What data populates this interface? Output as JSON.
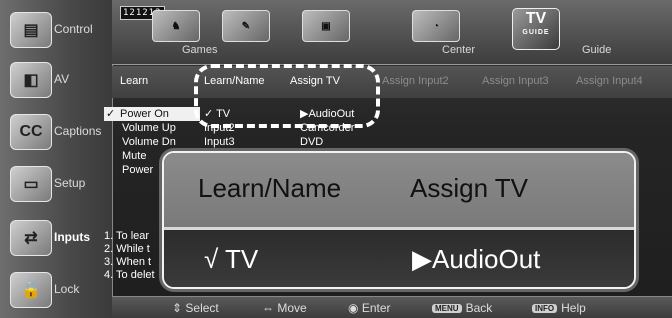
{
  "topbar": {
    "logo_digits": "121212",
    "tabs": [
      "Games",
      "",
      "Center",
      ""
    ],
    "tvguide": {
      "title": "TV",
      "sub": "GUIDE",
      "label": "Guide"
    }
  },
  "sidebar": {
    "items": [
      {
        "label": "Control",
        "icon": "tv-controls-icon"
      },
      {
        "label": "AV",
        "icon": "av-devices-icon"
      },
      {
        "label": "Captions",
        "icon": "cc-icon",
        "glyph": "CC"
      },
      {
        "label": "Setup",
        "icon": "setup-icon"
      },
      {
        "label": "Inputs",
        "icon": "inputs-icon"
      },
      {
        "label": "Lock",
        "icon": "lock-icon"
      }
    ]
  },
  "columns": {
    "learn": "Learn",
    "learn_name": "Learn/Name",
    "assign_tv": "Assign TV",
    "assign_input2": "Assign Input2",
    "assign_input3": "Assign Input3",
    "assign_input4": "Assign Input4"
  },
  "learn_items": [
    {
      "label": "Power On",
      "checked": true
    },
    {
      "label": "Volume Up"
    },
    {
      "label": "Volume Dn"
    },
    {
      "label": "Mute"
    },
    {
      "label": "Power"
    }
  ],
  "names": [
    "✓ TV",
    "Input2",
    "Input3"
  ],
  "assigns": [
    "▶AudioOut",
    "Camcorder",
    "DVD"
  ],
  "instructions": [
    "1. To lear",
    "2. While t",
    "3. When t",
    "4. To delet"
  ],
  "callout": {
    "head_left": "Learn/Name",
    "head_right": "Assign TV",
    "row_left": "√ TV",
    "row_right": "▶AudioOut"
  },
  "helpbar": {
    "select": "Select",
    "move": "Move",
    "enter": "Enter",
    "back_key": "MENU",
    "back": "Back",
    "help_key": "INFO",
    "help": "Help"
  }
}
